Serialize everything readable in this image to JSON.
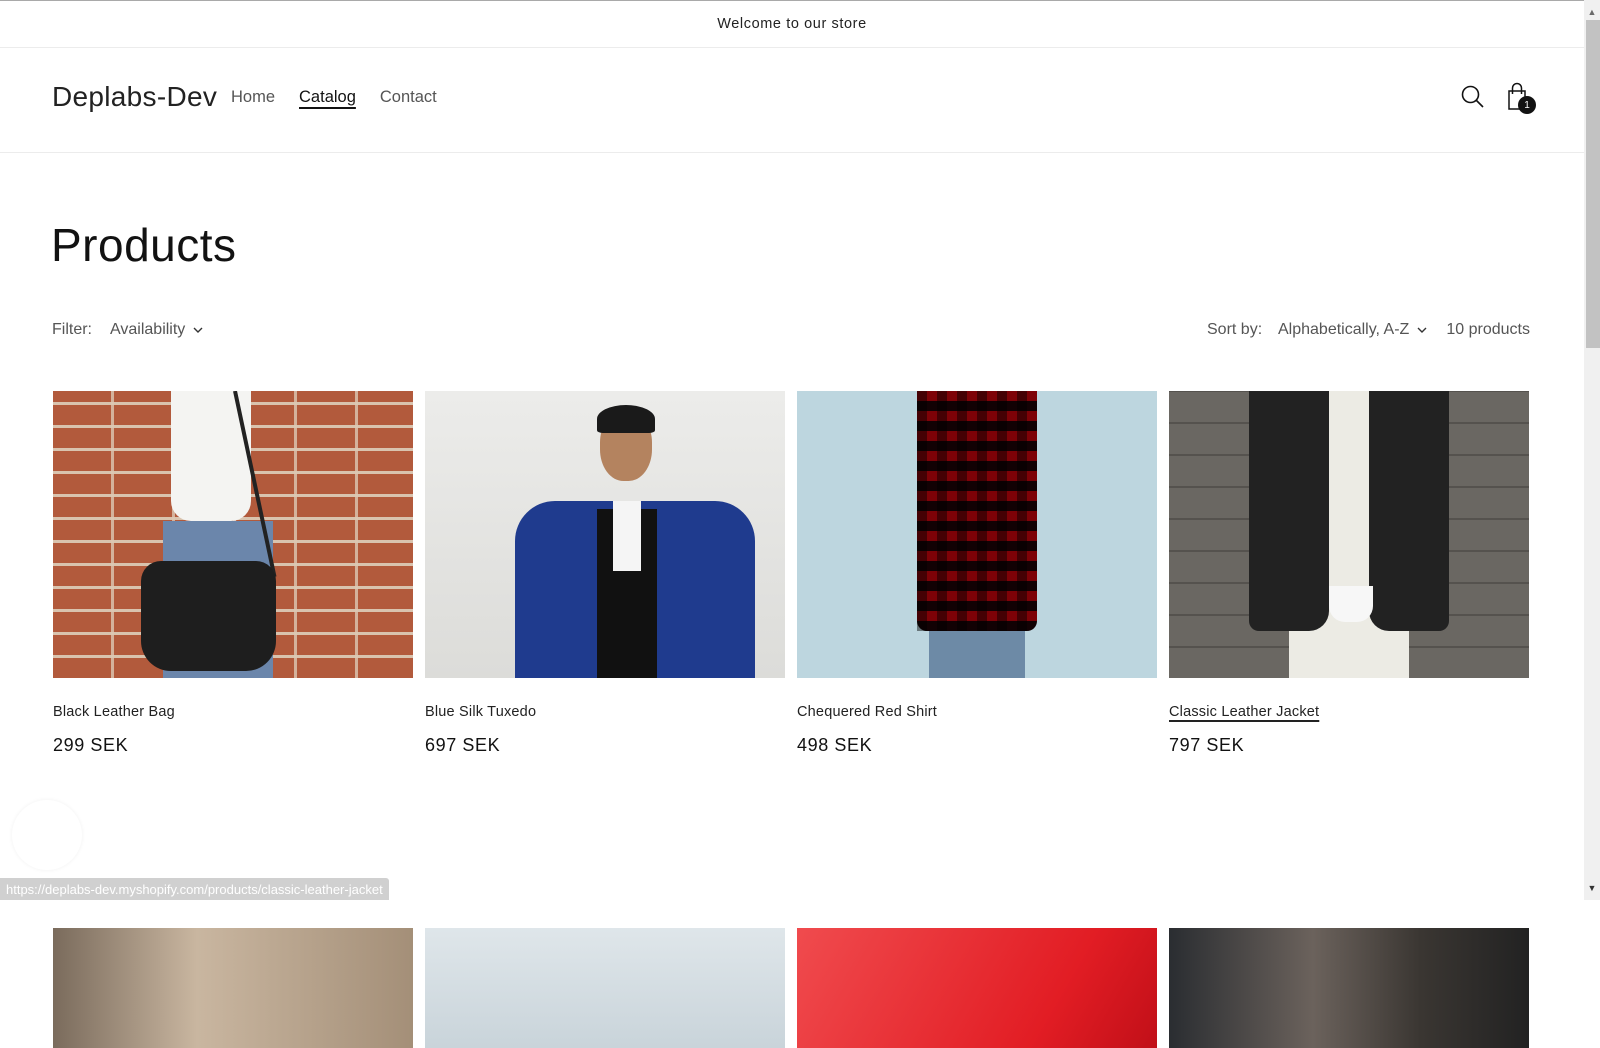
{
  "announcement": "Welcome to our store",
  "header": {
    "logo": "Deplabs-Dev",
    "nav": [
      {
        "label": "Home",
        "active": false
      },
      {
        "label": "Catalog",
        "active": true
      },
      {
        "label": "Contact",
        "active": false
      }
    ],
    "icons": {
      "search": "search-icon",
      "cart": "shopping-bag-icon"
    },
    "cart_count": "1"
  },
  "page": {
    "title": "Products",
    "filter_label": "Filter:",
    "filter_value": "Availability",
    "sort_label": "Sort by:",
    "sort_value": "Alphabetically, A-Z",
    "product_count": "10 products"
  },
  "products": [
    {
      "name": "Black Leather Bag",
      "price": "299 SEK"
    },
    {
      "name": "Blue Silk Tuxedo",
      "price": "697 SEK"
    },
    {
      "name": "Chequered Red Shirt",
      "price": "498 SEK"
    },
    {
      "name": "Classic Leather Jacket",
      "price": "797 SEK",
      "hovered": true
    }
  ],
  "status_url": "https://deplabs-dev.myshopify.com/products/classic-leather-jacket"
}
